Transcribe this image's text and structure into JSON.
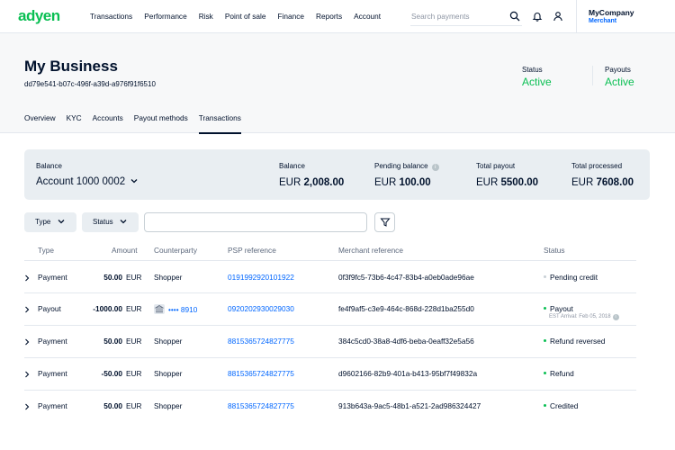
{
  "brand": {
    "logo_text": "adyen",
    "accent": "#0abf53",
    "link": "#0066ff"
  },
  "nav": {
    "items": [
      "Transactions",
      "Performance",
      "Risk",
      "Point of sale",
      "Finance",
      "Reports",
      "Account"
    ],
    "search_placeholder": "Search payments",
    "company": "MyCompany",
    "role": "Merchant",
    "icons": [
      "search-icon",
      "bell-icon",
      "user-icon"
    ]
  },
  "header": {
    "title": "My Business",
    "id": "dd79e541-b07c-496f-a39d-a976f91f6510",
    "status_label": "Status",
    "status_value": "Active",
    "payouts_label": "Payouts",
    "payouts_value": "Active"
  },
  "tabs": [
    "Overview",
    "KYC",
    "Accounts",
    "Payout methods",
    "Transactions"
  ],
  "active_tab": "Transactions",
  "balance": {
    "label": "Balance",
    "account": "Account 1000 0002",
    "balance_label": "Balance",
    "balance_currency": "EUR",
    "balance_value": "2,008.00",
    "pending_label": "Pending balance",
    "pending_currency": "EUR",
    "pending_value": "100.00",
    "payout_label": "Total payout",
    "payout_currency": "EUR",
    "payout_value": "5500.00",
    "processed_label": "Total processed",
    "processed_currency": "EUR",
    "processed_value": "7608.00"
  },
  "filters": {
    "type_label": "Type",
    "status_label": "Status",
    "search_value": ""
  },
  "table": {
    "headers": [
      "Type",
      "Amount",
      "Counterparty",
      "PSP reference",
      "Merchant reference",
      "Status"
    ],
    "rows": [
      {
        "type": "Payment",
        "amount": "50.00",
        "currency": "EUR",
        "counterparty": "Shopper",
        "psp": "0191992920101922",
        "merchant_ref": "0f3f9fc5-73b6-4c47-83b4-a0eb0ade96ae",
        "status": "Pending credit",
        "status_color": "#c8d0d6",
        "eta": ""
      },
      {
        "type": "Payout",
        "amount": "-1000.00",
        "currency": "EUR",
        "counterparty": "•••• 8910",
        "psp": "0920202930029030",
        "merchant_ref": "fe4f9af5-c3e9-464c-868d-228d1ba255d0",
        "status": "Payout",
        "status_color": "#0abf53",
        "eta": "EST Arrival: Feb 05, 2018"
      },
      {
        "type": "Payment",
        "amount": "50.00",
        "currency": "EUR",
        "counterparty": "Shopper",
        "psp": "8815365724827775",
        "merchant_ref": "384c5cd0-38a8-4df6-beba-0eaff32e5a56",
        "status": "Refund reversed",
        "status_color": "#0abf53",
        "eta": ""
      },
      {
        "type": "Payment",
        "amount": "-50.00",
        "currency": "EUR",
        "counterparty": "Shopper",
        "psp": "8815365724827775",
        "merchant_ref": "d9602166-82b9-401a-b413-95bf7f49832a",
        "status": "Refund",
        "status_color": "#0abf53",
        "eta": ""
      },
      {
        "type": "Payment",
        "amount": "50.00",
        "currency": "EUR",
        "counterparty": "Shopper",
        "psp": "8815365724827775",
        "merchant_ref": "913b643a-9ac5-48b1-a521-2ad986324427",
        "status": "Credited",
        "status_color": "#0abf53",
        "eta": ""
      }
    ]
  }
}
